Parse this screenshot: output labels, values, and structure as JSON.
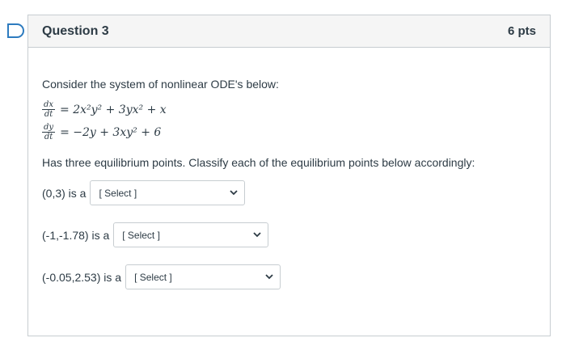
{
  "question": {
    "title": "Question 3",
    "points": "6 pts",
    "intro": "Consider the system of nonlinear ODE's below:",
    "eq1": {
      "num": "dx",
      "den": "dt",
      "rhs": "= 2x²y² + 3yx² + x"
    },
    "eq2": {
      "num": "dy",
      "den": "dt",
      "rhs": "= −2y + 3xy² + 6"
    },
    "instruction": "Has three equilibrium points. Classify each of the equilibrium points below accordingly:",
    "items": [
      {
        "label": "(0,3) is a",
        "selected": "[ Select ]"
      },
      {
        "label": "(-1,-1.78) is a",
        "selected": "[ Select ]"
      },
      {
        "label": "(-0.05,2.53) is a",
        "selected": "[ Select ]"
      }
    ]
  },
  "colors": {
    "text": "#2d3b45",
    "border": "#c7cdd1",
    "header_bg": "#f5f5f5",
    "flag": "#2d7bbf"
  },
  "icons": {
    "flag": "flag-icon",
    "chevron": "chevron-down-icon"
  }
}
